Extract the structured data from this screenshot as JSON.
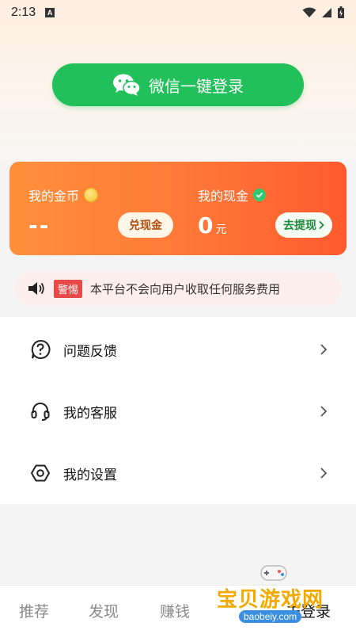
{
  "status_bar": {
    "time": "2:13",
    "a_glyph": "A"
  },
  "login": {
    "label": "微信一键登录",
    "icon": "wechat-icon"
  },
  "wallet": {
    "coin_title": "我的金币",
    "coin_value": "--",
    "exchange_label": "兑现金",
    "cash_title": "我的现金",
    "cash_value": "0",
    "cash_unit": "元",
    "withdraw_label": "去提现",
    "colors": {
      "start": "#ff8f3a",
      "end": "#ff5a2e"
    }
  },
  "notice": {
    "badge": "警惕",
    "text": "本平台不会向用户收取任何服务费用"
  },
  "menu": [
    {
      "label": "问题反馈",
      "icon": "question-icon"
    },
    {
      "label": "我的客服",
      "icon": "headset-icon"
    },
    {
      "label": "我的设置",
      "icon": "settings-icon"
    }
  ],
  "tabs": [
    "推荐",
    "发现",
    "赚钱",
    "未登录"
  ],
  "watermark": {
    "text": "宝贝游戏网",
    "url": "baobeiy.com"
  },
  "colors": {
    "accent_green": "#21c05b",
    "notice_red": "#e84a4a"
  }
}
